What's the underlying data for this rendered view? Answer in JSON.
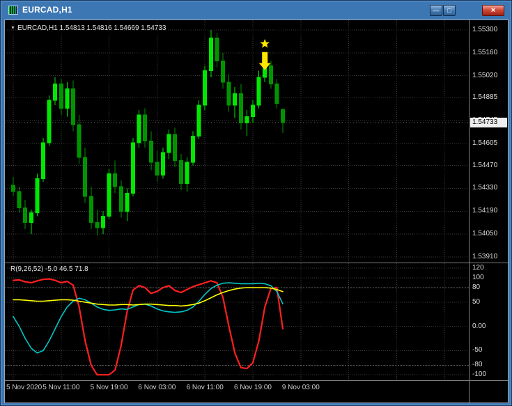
{
  "window": {
    "title": "EURCAD,H1",
    "controls": {
      "minimize": "—",
      "maximize": "□",
      "close": "×"
    }
  },
  "chart": {
    "legend_marker": "▼",
    "legend_symbol": "EURCAD,H1",
    "legend_ohlc": "1.54813 1.54816 1.54669 1.54733",
    "price_axis": [
      "1.55300",
      "1.55160",
      "1.55020",
      "1.54885",
      "1.54745",
      "1.54605",
      "1.54470",
      "1.54330",
      "1.54190",
      "1.54050",
      "1.53910"
    ],
    "price_tag": "1.54733",
    "time_axis": [
      "5 Nov 2020",
      "5 Nov 11:00",
      "5 Nov 19:00",
      "6 Nov 03:00",
      "6 Nov 11:00",
      "6 Nov 19:00",
      "9 Nov 03:00"
    ]
  },
  "indicator": {
    "legend": "R(9,26,52) -5.0 46.5 71.8",
    "axis": [
      "120",
      "100",
      "80",
      "50",
      "0.00",
      "-50",
      "-80",
      "-100"
    ]
  },
  "chart_data": {
    "type": "candlestick",
    "symbol": "EURCAD",
    "timeframe": "H1",
    "ylim": [
      1.5391,
      1.553
    ],
    "candles": [
      [
        1.5435,
        1.544,
        1.5428,
        1.5431
      ],
      [
        1.5431,
        1.5434,
        1.5418,
        1.5421
      ],
      [
        1.5421,
        1.5426,
        1.5408,
        1.5412
      ],
      [
        1.5412,
        1.542,
        1.5405,
        1.5418
      ],
      [
        1.5418,
        1.5442,
        1.5416,
        1.5439
      ],
      [
        1.5439,
        1.5464,
        1.5437,
        1.5461
      ],
      [
        1.5461,
        1.549,
        1.5459,
        1.5487
      ],
      [
        1.5487,
        1.5501,
        1.5484,
        1.5497
      ],
      [
        1.5497,
        1.55,
        1.5478,
        1.5482
      ],
      [
        1.5482,
        1.5498,
        1.5477,
        1.5494
      ],
      [
        1.5494,
        1.5499,
        1.5468,
        1.5472
      ],
      [
        1.5472,
        1.5478,
        1.5448,
        1.5452
      ],
      [
        1.5452,
        1.5458,
        1.5424,
        1.5428
      ],
      [
        1.5428,
        1.5434,
        1.5408,
        1.5412
      ],
      [
        1.5412,
        1.542,
        1.5404,
        1.5409
      ],
      [
        1.5409,
        1.5419,
        1.5405,
        1.5416
      ],
      [
        1.5416,
        1.5445,
        1.5414,
        1.5442
      ],
      [
        1.5442,
        1.545,
        1.543,
        1.5434
      ],
      [
        1.5434,
        1.5438,
        1.5415,
        1.5419
      ],
      [
        1.5419,
        1.5433,
        1.5413,
        1.543
      ],
      [
        1.543,
        1.5464,
        1.5428,
        1.5461
      ],
      [
        1.5461,
        1.5481,
        1.5458,
        1.5478
      ],
      [
        1.5478,
        1.5482,
        1.5458,
        1.5462
      ],
      [
        1.5462,
        1.5468,
        1.5444,
        1.5449
      ],
      [
        1.5449,
        1.5456,
        1.5437,
        1.5441
      ],
      [
        1.5441,
        1.5458,
        1.5439,
        1.5455
      ],
      [
        1.5455,
        1.5469,
        1.5451,
        1.5466
      ],
      [
        1.5466,
        1.547,
        1.5446,
        1.545
      ],
      [
        1.545,
        1.5454,
        1.5432,
        1.5436
      ],
      [
        1.5436,
        1.5452,
        1.5431,
        1.5449
      ],
      [
        1.5449,
        1.5468,
        1.5447,
        1.5465
      ],
      [
        1.5465,
        1.5487,
        1.5463,
        1.5484
      ],
      [
        1.5484,
        1.5508,
        1.5481,
        1.5505
      ],
      [
        1.5505,
        1.553,
        1.5501,
        1.5525
      ],
      [
        1.5525,
        1.5528,
        1.5507,
        1.5511
      ],
      [
        1.5511,
        1.5516,
        1.5494,
        1.5498
      ],
      [
        1.5498,
        1.5503,
        1.548,
        1.5484
      ],
      [
        1.5484,
        1.5495,
        1.5476,
        1.5491
      ],
      [
        1.5491,
        1.5497,
        1.5469,
        1.5473
      ],
      [
        1.5473,
        1.5481,
        1.5465,
        1.5477
      ],
      [
        1.5477,
        1.5487,
        1.5473,
        1.5484
      ],
      [
        1.5484,
        1.5505,
        1.5482,
        1.5501
      ],
      [
        1.5501,
        1.5513,
        1.5498,
        1.5508
      ],
      [
        1.5508,
        1.5511,
        1.5494,
        1.5497
      ],
      [
        1.5497,
        1.55,
        1.5482,
        1.5485
      ],
      [
        1.54813,
        1.54816,
        1.54669,
        1.54733
      ]
    ],
    "markers": {
      "star_bar": 42,
      "star_price": 1.55215,
      "arrow_bar": 42,
      "arrow_top_price": 1.55165,
      "arrow_bottom_price": 1.55055
    },
    "colors": {
      "bull": "#00e800",
      "bear": "#009500",
      "grid": "#3a3a3a",
      "background": "#000000",
      "marker": "#ffe600",
      "axis_text": "#dcdcdc"
    },
    "indicator": {
      "name": "R(9,26,52)",
      "current_values": [
        -5.0,
        46.5,
        71.8
      ],
      "ticks": [
        120,
        100,
        80,
        50,
        0,
        -50,
        -80,
        -100
      ],
      "levels": [
        80,
        -80
      ],
      "series": [
        {
          "name": "r-line-red",
          "color": "#ff2020",
          "width": 2.2,
          "values": [
            95,
            96,
            92,
            90,
            94,
            97,
            98,
            95,
            90,
            93,
            85,
            40,
            -30,
            -80,
            -100,
            -100,
            -100,
            -90,
            -40,
            30,
            75,
            84,
            80,
            68,
            72,
            80,
            84,
            74,
            70,
            76,
            82,
            86,
            90,
            94,
            90,
            60,
            0,
            -55,
            -85,
            -87,
            -75,
            -30,
            40,
            78,
            80,
            -5
          ]
        },
        {
          "name": "r-line-cyan",
          "color": "#00c8c8",
          "width": 1.6,
          "values": [
            20,
            0,
            -25,
            -45,
            -55,
            -50,
            -30,
            -5,
            20,
            40,
            52,
            58,
            55,
            48,
            40,
            35,
            33,
            34,
            36,
            35,
            40,
            45,
            46,
            42,
            36,
            32,
            30,
            29,
            30,
            33,
            40,
            52,
            66,
            78,
            85,
            89,
            90,
            89,
            88,
            88,
            88,
            89,
            88,
            84,
            72,
            46.5
          ]
        },
        {
          "name": "r-line-yellow",
          "color": "#ffff00",
          "width": 1.6,
          "values": [
            55,
            55,
            54,
            53,
            52,
            52,
            53,
            54,
            55,
            55,
            54,
            52,
            50,
            48,
            46,
            45,
            44,
            44,
            45,
            45,
            44,
            45,
            46,
            46,
            45,
            44,
            43,
            43,
            42,
            43,
            45,
            48,
            53,
            59,
            65,
            70,
            74,
            77,
            79,
            80,
            80,
            80,
            80,
            79,
            76,
            71.8
          ]
        }
      ]
    },
    "time_label_bars": [
      0,
      8,
      16,
      24,
      32,
      40,
      48
    ]
  }
}
